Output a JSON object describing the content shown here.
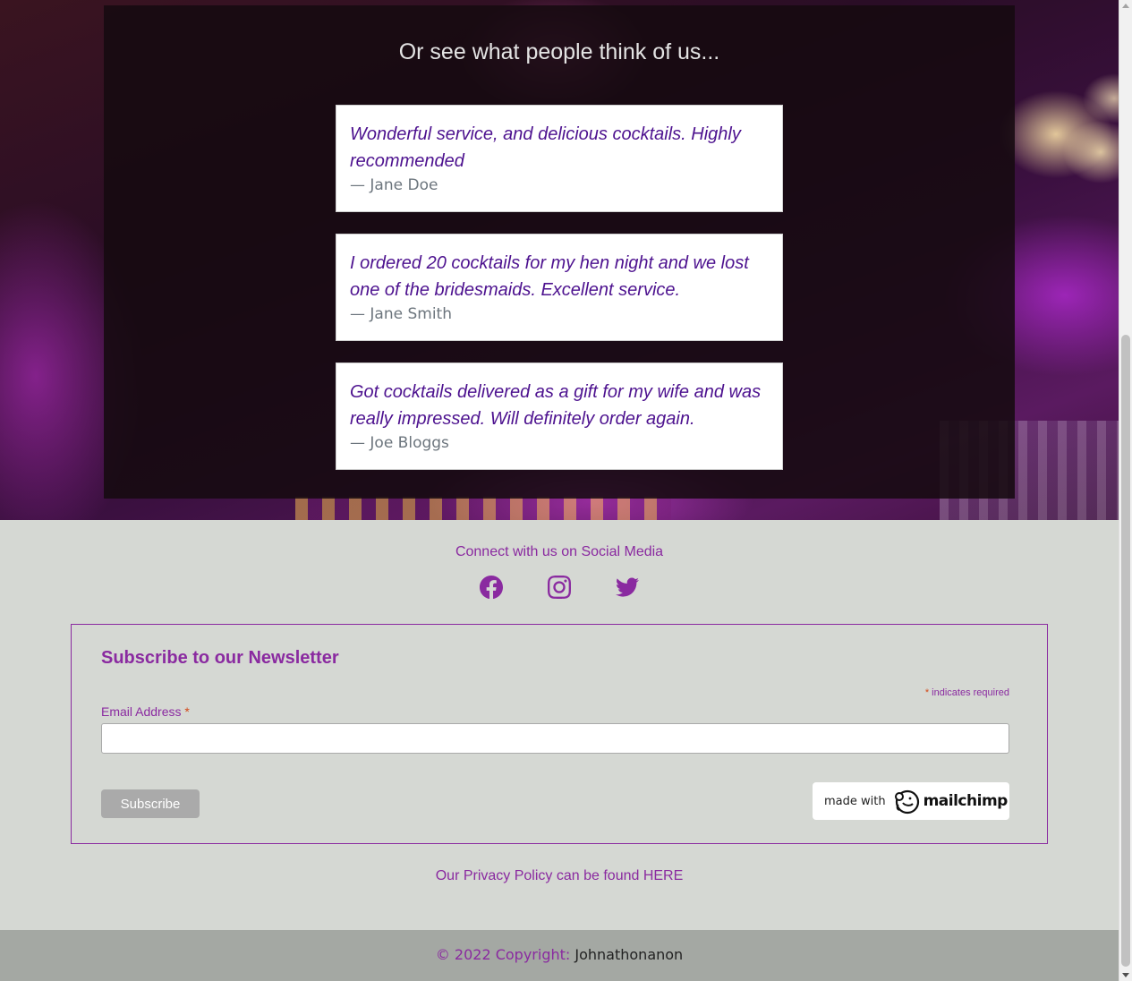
{
  "testimonials": {
    "heading": "Or see what people think of us...",
    "items": [
      {
        "quote": "Wonderful service, and delicious cocktails. Highly recommended",
        "author": "— Jane Doe"
      },
      {
        "quote": "I ordered 20 cocktails for my hen night and we lost one of the bridesmaids. Excellent service.",
        "author": "— Jane Smith"
      },
      {
        "quote": "Got cocktails delivered as a gift for my wife and was really impressed. Will definitely order again.",
        "author": "— Joe Bloggs"
      }
    ]
  },
  "social": {
    "heading": "Connect with us on Social Media",
    "icons": [
      "facebook-icon",
      "instagram-icon",
      "twitter-icon"
    ]
  },
  "newsletter": {
    "title": "Subscribe to our Newsletter",
    "required_star": "*",
    "required_note": "indicates required",
    "email_label": "Email Address",
    "email_value": "",
    "subscribe_label": "Subscribe",
    "badge_prefix": "made with",
    "badge_brand": "mailchimp"
  },
  "privacy": {
    "text": "Our Privacy Policy can be found HERE"
  },
  "copyright": {
    "label": "© 2022 Copyright:",
    "owner": "Johnathonanon"
  },
  "colors": {
    "accent": "#8a2aa0",
    "quote_text": "#4d128f",
    "footer_bg": "#d5d8d3",
    "copyright_bg": "#a4a8a3"
  }
}
